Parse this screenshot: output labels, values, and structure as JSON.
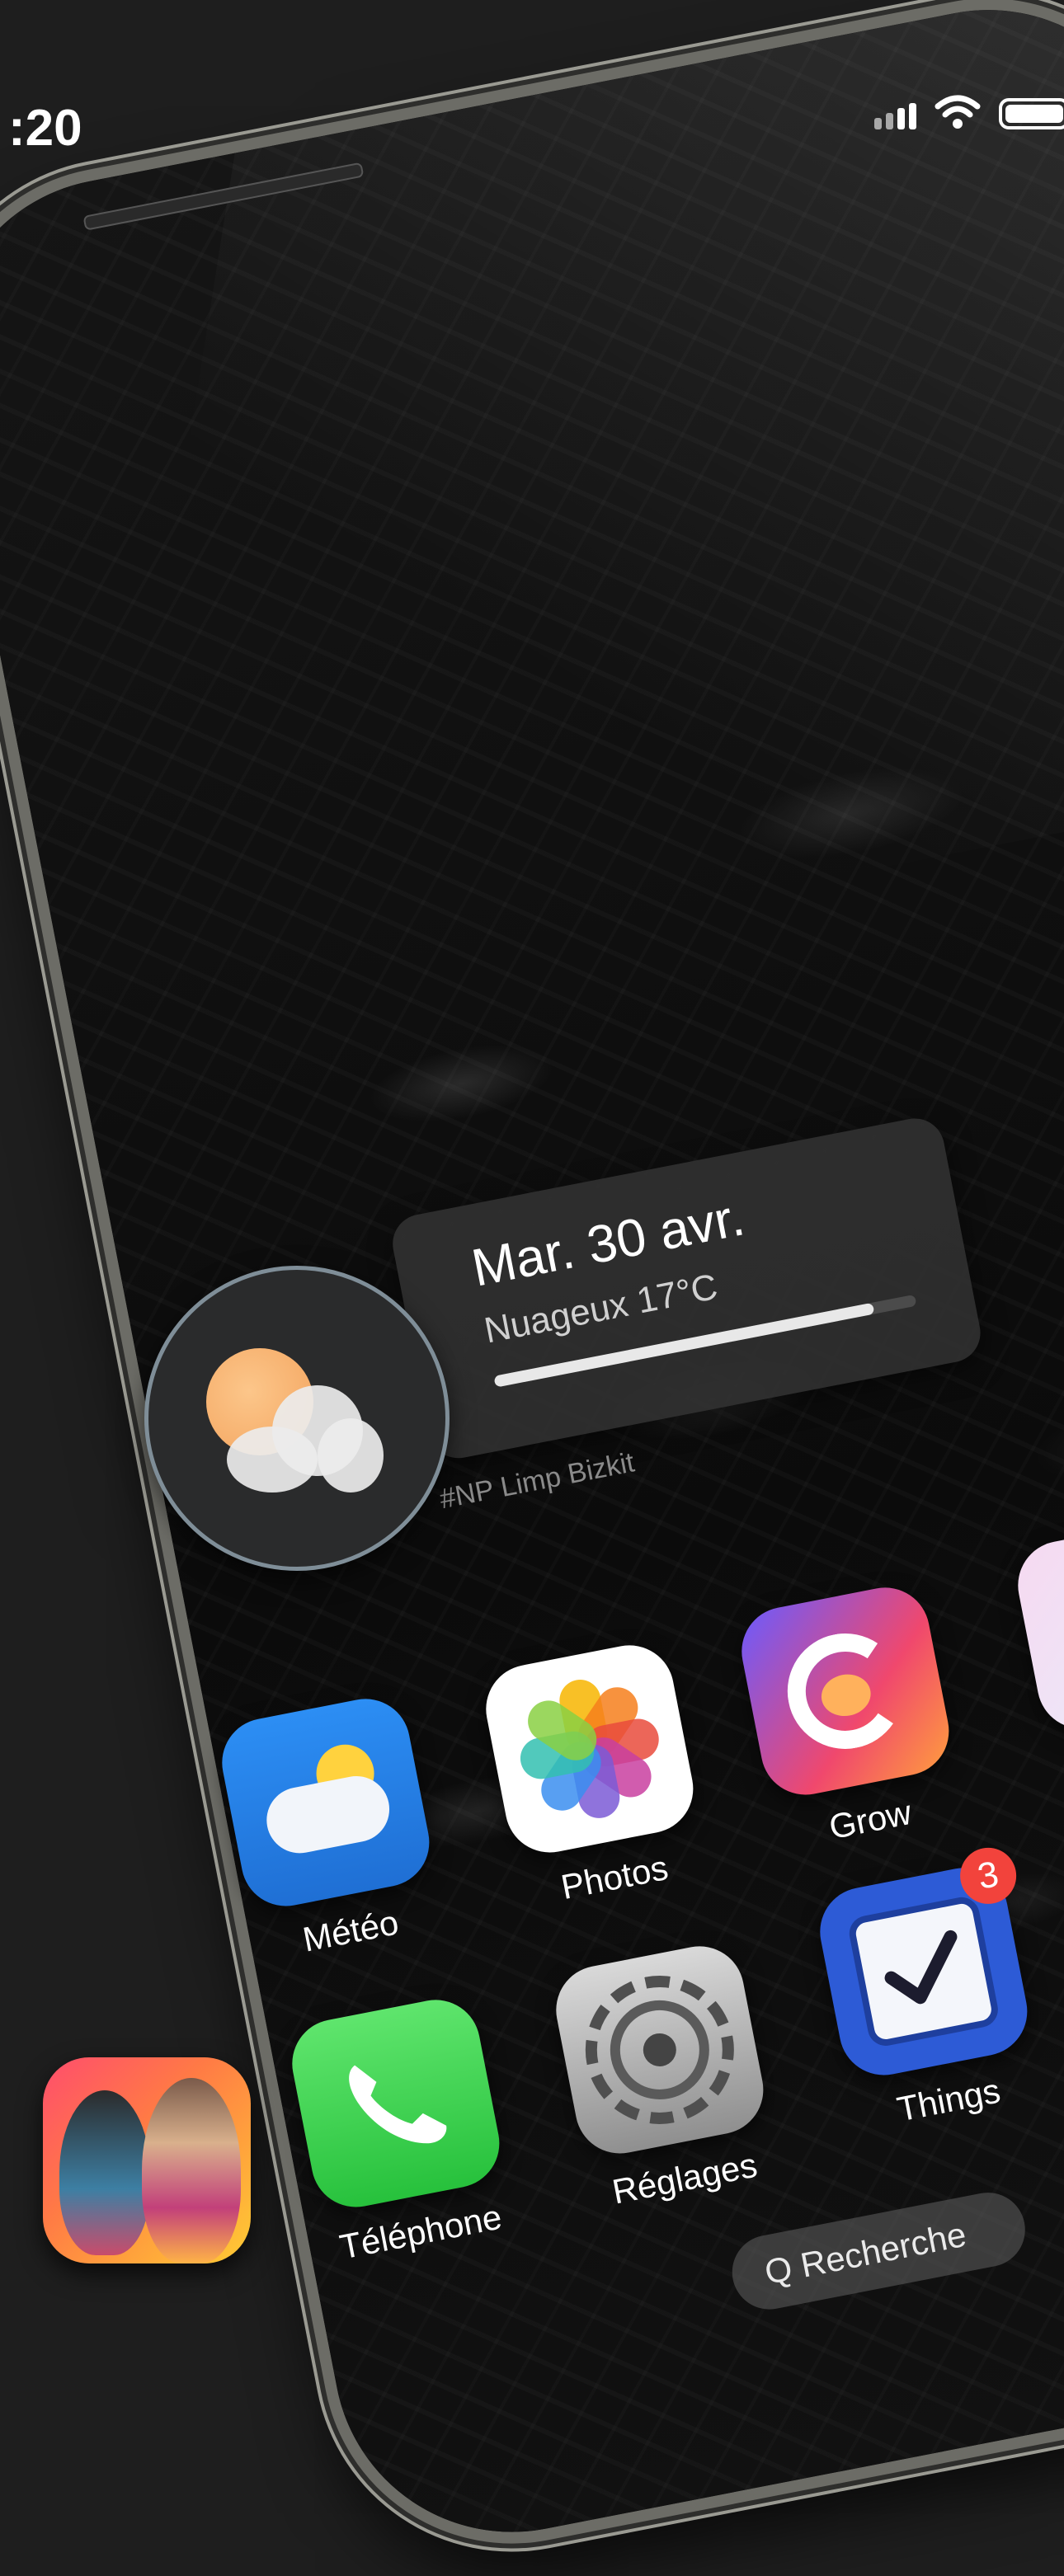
{
  "status_bar": {
    "time": ":20",
    "signal_bars": 4,
    "battery_level": 1.0
  },
  "widget": {
    "date": "Mar. 30 avr.",
    "condition": "Nuageux 17°C",
    "progress": 0.9,
    "caption": "#NP Limp Bizkit"
  },
  "apps": [
    {
      "label": "Météo"
    },
    {
      "label": "Photos"
    },
    {
      "label": "Grow"
    },
    {
      "label": "Things",
      "badge": "3"
    },
    {
      "label": "Téléphone"
    },
    {
      "label": "Réglages"
    },
    {
      "label": ""
    }
  ],
  "search": {
    "label": "Q Recherche"
  },
  "colors": {
    "background": "#1e1e1e",
    "badge": "#f2433c",
    "widget_card": "#303030"
  }
}
